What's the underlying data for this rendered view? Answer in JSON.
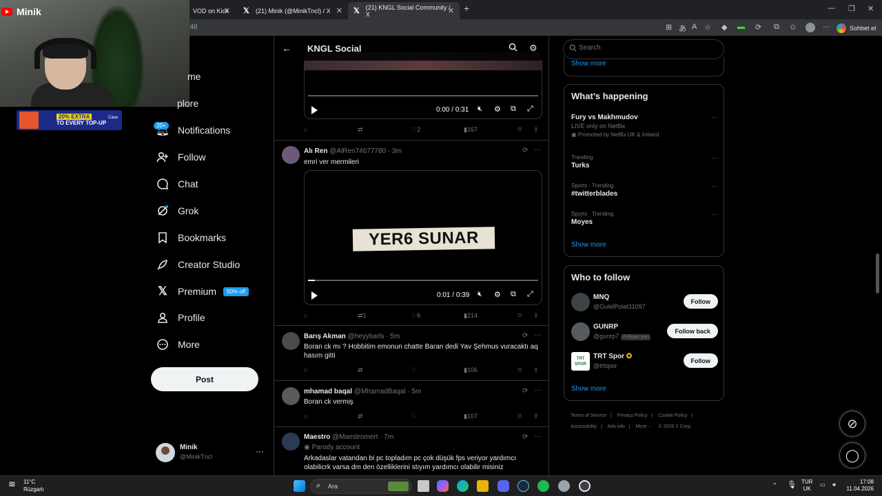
{
  "browser": {
    "tabs": [
      {
        "label": "VOD on Kick",
        "active": false
      },
      {
        "label": "(21) Minik (@MinikTncl) / X",
        "active": false
      },
      {
        "label": "(21) KNGL Social Community / X",
        "active": true
      }
    ],
    "new_tab": "+",
    "address_fragment": "746",
    "sohbet_label": "Sohbet et"
  },
  "overlay": {
    "channel_name": "Minik",
    "promo_pct": "20% EXTRA",
    "promo_sub": "TO EVERY TOP-UP",
    "promo_brand": "Case"
  },
  "nav": {
    "items": [
      {
        "label": "me",
        "icon": "home-icon"
      },
      {
        "label": "plore",
        "icon": "explore-icon"
      },
      {
        "label": "Notifications",
        "icon": "bell-icon"
      },
      {
        "label": "Follow",
        "icon": "follow-icon"
      },
      {
        "label": "Chat",
        "icon": "chat-icon"
      },
      {
        "label": "Grok",
        "icon": "grok-icon"
      },
      {
        "label": "Bookmarks",
        "icon": "bookmark-icon"
      },
      {
        "label": "Creator Studio",
        "icon": "rocket-icon"
      },
      {
        "label": "Premium",
        "icon": "x-logo-icon"
      },
      {
        "label": "Profile",
        "icon": "profile-icon"
      },
      {
        "label": "More",
        "icon": "more-icon"
      }
    ],
    "notifications_badge": "20+",
    "premium_badge": "50% off",
    "post_label": "Post",
    "account": {
      "name": "Minik",
      "handle": "@MinikTncl"
    }
  },
  "center": {
    "title": "KNGL Social",
    "tweets": [
      {
        "video": {
          "current": "0:00",
          "duration": "0:31",
          "separator": "/",
          "progress": 0.0
        },
        "stats": {
          "reply": "",
          "retweet": "",
          "like": "2",
          "views": "167"
        }
      },
      {
        "name": "Alı Ren",
        "handle": "@AlRen74677780",
        "time": "· 3m",
        "text": "emri ver mermileri",
        "video": {
          "caption": "YER6 SUNAR",
          "current": "0:01",
          "duration": "0:39",
          "separator": "/",
          "progress": 0.03
        },
        "stats": {
          "reply": "",
          "retweet": "1",
          "like": "6",
          "views": "214"
        }
      },
      {
        "name": "Barış Akman",
        "handle": "@heyybarls",
        "time": "· 5m",
        "text": "Boran ck mı ? Hobbitim emonun chatte Baran dedi Yav Şehmus vuracaktı aq hasım gitti",
        "stats": {
          "reply": "",
          "retweet": "",
          "like": "",
          "views": "106"
        }
      },
      {
        "name": "mhamad baqal",
        "handle": "@MhamadBaqal",
        "time": "· 5m",
        "text": "Boran ck vermiş",
        "stats": {
          "reply": "",
          "retweet": "",
          "like": "",
          "views": "107"
        }
      },
      {
        "name": "Maestro",
        "handle": "@Maestromert",
        "time": "· 7m",
        "badge": "Parody account",
        "text": "Arkadaslar vatandan bi pc topladım pc çok düşük fps veriyor yardımcı olabilicrk varsa dm den özelliklerini stıyım yardımcı olabilir misiniz"
      }
    ]
  },
  "right": {
    "search_placeholder": "Search",
    "top_show_more": "Show more",
    "happening": {
      "title": "What’s happening",
      "trends": [
        {
          "context": "",
          "title": "Fury vs Makhmudov",
          "sub": "LIVE only on Netflix",
          "promo": "Promoted by Netflix UK & Ireland"
        },
        {
          "context": "Trending",
          "title": "Turks"
        },
        {
          "context": "Sports · Trending",
          "title": "#twitterblades"
        },
        {
          "context": "Sports · Trending",
          "title": "Moyes"
        }
      ],
      "show_more": "Show more"
    },
    "who_to_follow": {
      "title": "Who to follow",
      "accounts": [
        {
          "name": "MNQ",
          "handle": "@GulelPolat31097",
          "button": "Follow"
        },
        {
          "name": "GUNRP",
          "handle": "@gunrp7",
          "tag": "Follows you",
          "button": "Follow back"
        },
        {
          "name": "TRT Spor",
          "handle": "@trtspor",
          "button": "Follow",
          "avatar_text": "TRT SPOR"
        }
      ],
      "show_more": "Show more"
    },
    "footer": [
      "Terms of Service",
      "|",
      "Privacy Policy",
      "|",
      "Cookie Policy",
      "|",
      "Accessibility",
      "|",
      "Ads info",
      "|",
      "More ···",
      "© 2026 X Corp."
    ]
  },
  "taskbar": {
    "weather_temp": "11°C",
    "weather_desc": "Rüzgarlı",
    "search_label": "Ara",
    "lang_top": "TUR",
    "lang_bottom": "UK",
    "time": "17:08",
    "date": "11.04.2026"
  },
  "colors": {
    "accent": "#1d9bf0",
    "background": "#000000",
    "border": "#2f3336"
  }
}
